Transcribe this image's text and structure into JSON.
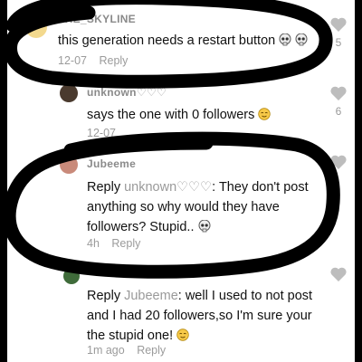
{
  "comments": [
    {
      "username": "THE_SKYLINE",
      "text": "this generation needs a restart button",
      "emoji": [
        "skull-emoji",
        "skull-emoji"
      ],
      "time": "12-07",
      "reply_label": "Reply",
      "likes": "5",
      "avatar_color": "#f3d98e"
    },
    {
      "username": "unknown♡♡♡",
      "text": "says the one with 0 followers",
      "emoji": [
        "relieved-face-emoji"
      ],
      "time": "12-07",
      "likes": "6",
      "avatar_color": "#4a3a2e"
    },
    {
      "username": "Jubeeme",
      "reply_prefix": "Reply",
      "mention": "unknown♡♡♡",
      "text": ": They don't post anything so why would they have followers? Stupid..",
      "emoji": [
        "skull-emoji"
      ],
      "time": "4h",
      "reply_label": "Reply",
      "avatar_color": "#c98a7a"
    },
    {
      "reply_prefix": "Reply",
      "mention": "Jubeeme",
      "text": ": well I used to not post and I had 20 followers,so I'm sure your the stupid one!",
      "emoji": [
        "relieved-face-emoji"
      ],
      "time": "1m ago",
      "reply_label": "Reply",
      "avatar_color": "#3f6b3a"
    }
  ],
  "colors": {
    "username": "#8a8a8a",
    "text": "#111111",
    "meta": "#9b9b9b",
    "heart": "#bdbdbd",
    "scribble": "#000000",
    "frame_background": "#000000"
  }
}
